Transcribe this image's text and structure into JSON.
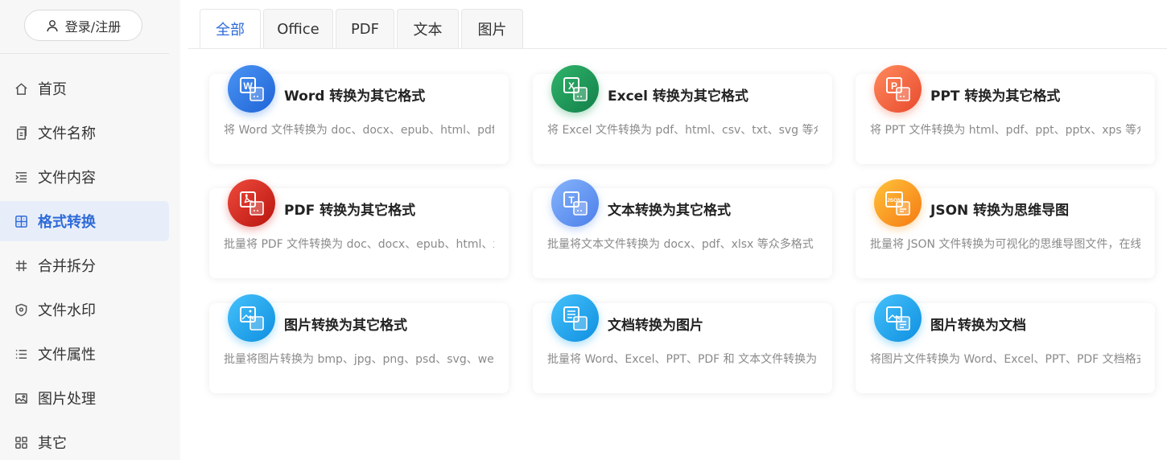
{
  "sidebar": {
    "login_label": "登录/注册",
    "items": [
      {
        "label": "首页",
        "icon": "home-icon"
      },
      {
        "label": "文件名称",
        "icon": "file-copy-icon"
      },
      {
        "label": "文件内容",
        "icon": "indent-icon"
      },
      {
        "label": "格式转换",
        "icon": "convert-icon",
        "active": true
      },
      {
        "label": "合并拆分",
        "icon": "hash-icon"
      },
      {
        "label": "文件水印",
        "icon": "shield-icon"
      },
      {
        "label": "文件属性",
        "icon": "list-icon"
      },
      {
        "label": "图片处理",
        "icon": "image-icon"
      },
      {
        "label": "其它",
        "icon": "grid-icon"
      }
    ]
  },
  "tabs": [
    "全部",
    "Office",
    "PDF",
    "文本",
    "图片"
  ],
  "active_tab": "全部",
  "accent_color": "#2f6bd8",
  "cards": [
    {
      "title": "Word 转换为其它格式",
      "desc": "将 Word 文件转换为 doc、docx、epub、html、pdf 等众多格式",
      "icon": "word-icon",
      "color": "#2f7be6",
      "letter": "W"
    },
    {
      "title": "Excel 转换为其它格式",
      "desc": "将 Excel 文件转换为 pdf、html、csv、txt、svg 等众多格式",
      "icon": "excel-icon",
      "color": "#1e9d58",
      "letter": "X"
    },
    {
      "title": "PPT 转换为其它格式",
      "desc": "将 PPT 文件转换为 html、pdf、ppt、pptx、xps 等众多格式",
      "icon": "ppt-icon",
      "color": "#f0653f",
      "letter": "P"
    },
    {
      "title": "PDF 转换为其它格式",
      "desc": "批量将 PDF 文件转换为 doc、docx、epub、html、xls 等众多格式",
      "icon": "pdf-icon",
      "color": "#d5231f",
      "letter": "pdf"
    },
    {
      "title": "文本转换为其它格式",
      "desc": "批量将文本文件转换为 docx、pdf、xlsx 等众多格式",
      "icon": "text-icon",
      "color": "#5b8ff0",
      "letter": "T"
    },
    {
      "title": "JSON 转换为思维导图",
      "desc": "批量将 JSON 文件转换为可视化的思维导图文件，在线预览",
      "icon": "json-icon",
      "color": "#f99a1c",
      "letter": "JSON"
    },
    {
      "title": "图片转换为其它格式",
      "desc": "批量将图片转换为 bmp、jpg、png、psd、svg、webp 等众多格式",
      "icon": "image-convert-icon",
      "color": "#1ea8ef",
      "letter": "img"
    },
    {
      "title": "文档转换为图片",
      "desc": "批量将 Word、Excel、PPT、PDF 和 文本文件转换为图片",
      "icon": "doc-to-image-icon",
      "color": "#1ea8ef",
      "letter": "doc"
    },
    {
      "title": "图片转换为文档",
      "desc": "将图片文件转换为 Word、Excel、PPT、PDF 文档格式",
      "icon": "image-to-doc-icon",
      "color": "#1ea8ef",
      "letter": "imgdoc"
    }
  ]
}
